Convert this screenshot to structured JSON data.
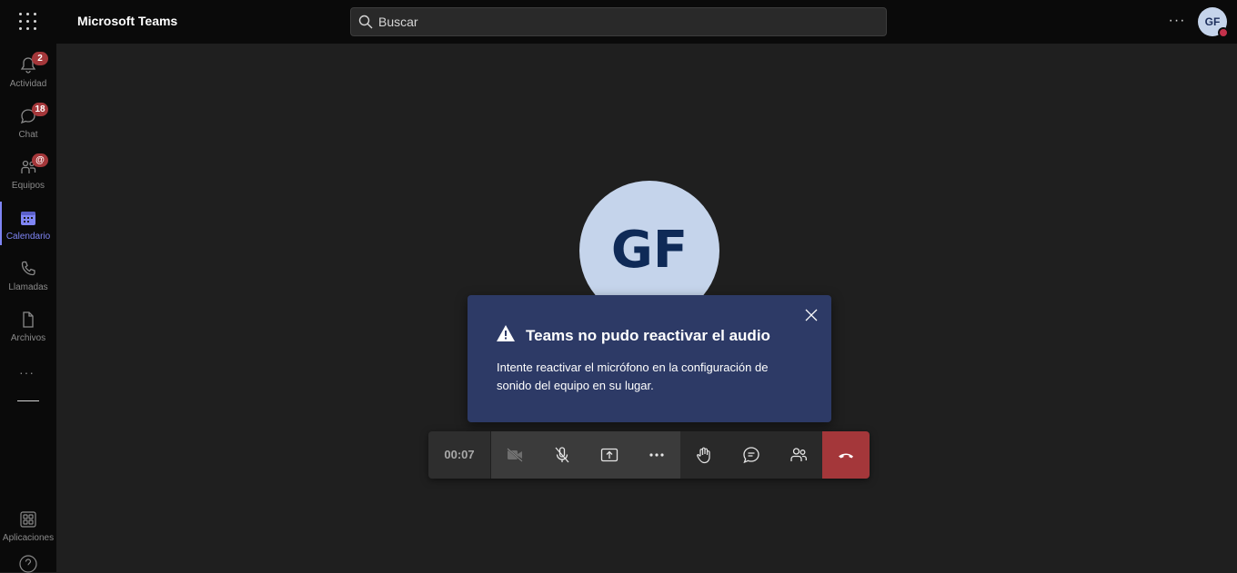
{
  "topbar": {
    "app_title": "Microsoft Teams",
    "search_placeholder": "Buscar",
    "avatar_initials": "GF"
  },
  "rail": {
    "items": [
      {
        "label": "Actividad",
        "icon": "bell-icon",
        "badge": "2"
      },
      {
        "label": "Chat",
        "icon": "chat-icon",
        "badge": "18"
      },
      {
        "label": "Equipos",
        "icon": "teams-icon",
        "badge": "@"
      },
      {
        "label": "Calendario",
        "icon": "calendar-icon",
        "active": true
      },
      {
        "label": "Llamadas",
        "icon": "phone-icon"
      },
      {
        "label": "Archivos",
        "icon": "file-icon"
      }
    ],
    "more": "···",
    "apps_label": "Aplicaciones"
  },
  "call": {
    "participant_initials": "GF",
    "timer": "00:07"
  },
  "toast": {
    "title": "Teams no pudo reactivar el audio",
    "body": "Intente reactivar el micrófono en la configuración de sonido del equipo en su lugar."
  },
  "colors": {
    "accent": "#7f85f5",
    "hangup": "#a4373a",
    "toast_bg": "#2d3a66",
    "avatar_bg": "#c5d4eb"
  }
}
